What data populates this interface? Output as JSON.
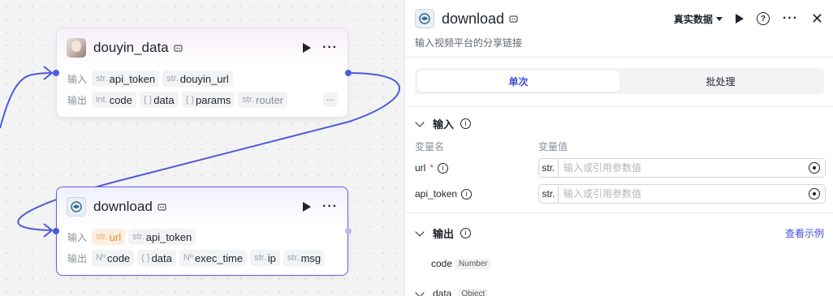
{
  "canvas": {
    "nodes": [
      {
        "title": "douyin_data",
        "input_label": "输入",
        "output_label": "输出",
        "inputs": [
          {
            "type": "str.",
            "name": "api_token"
          },
          {
            "type": "str.",
            "name": "douyin_url"
          }
        ],
        "outputs": [
          {
            "type": "int.",
            "name": "code"
          },
          {
            "type": "{ }",
            "name": "data"
          },
          {
            "type": "{ }",
            "name": "params"
          },
          {
            "type": "str.",
            "name": "router"
          }
        ],
        "more": "···"
      },
      {
        "title": "download",
        "input_label": "输入",
        "output_label": "输出",
        "inputs": [
          {
            "type": "str.",
            "name": "url"
          },
          {
            "type": "str.",
            "name": "api_token"
          }
        ],
        "outputs": [
          {
            "type": "Nº",
            "name": "code"
          },
          {
            "type": "{ }",
            "name": "data"
          },
          {
            "type": "Nº",
            "name": "exec_time"
          },
          {
            "type": "str.",
            "name": "ip"
          },
          {
            "type": "str.",
            "name": "msg"
          }
        ]
      }
    ]
  },
  "panel": {
    "title": "download",
    "description": "输入视频平台的分享链接",
    "data_select": "真实数据",
    "tabs": [
      {
        "label": "单次",
        "active": true
      },
      {
        "label": "批处理",
        "active": false
      }
    ],
    "input_section": {
      "title": "输入",
      "col_name": "变量名",
      "col_value": "变量值",
      "params": [
        {
          "name": "url",
          "required_mark": "*",
          "type": "str.",
          "placeholder": "输入或引用参数值"
        },
        {
          "name": "api_token",
          "required_mark": "",
          "type": "str.",
          "placeholder": "输入或引用参数值"
        }
      ]
    },
    "output_section": {
      "title": "输出",
      "link": "查看示例",
      "fields": [
        {
          "name": "code",
          "type": "Number"
        },
        {
          "name": "data",
          "type": "Object"
        }
      ]
    }
  },
  "colors": {
    "accent": "#3d4ed8",
    "port": "#4e5bd6",
    "selected_border": "#6b5cf0"
  }
}
